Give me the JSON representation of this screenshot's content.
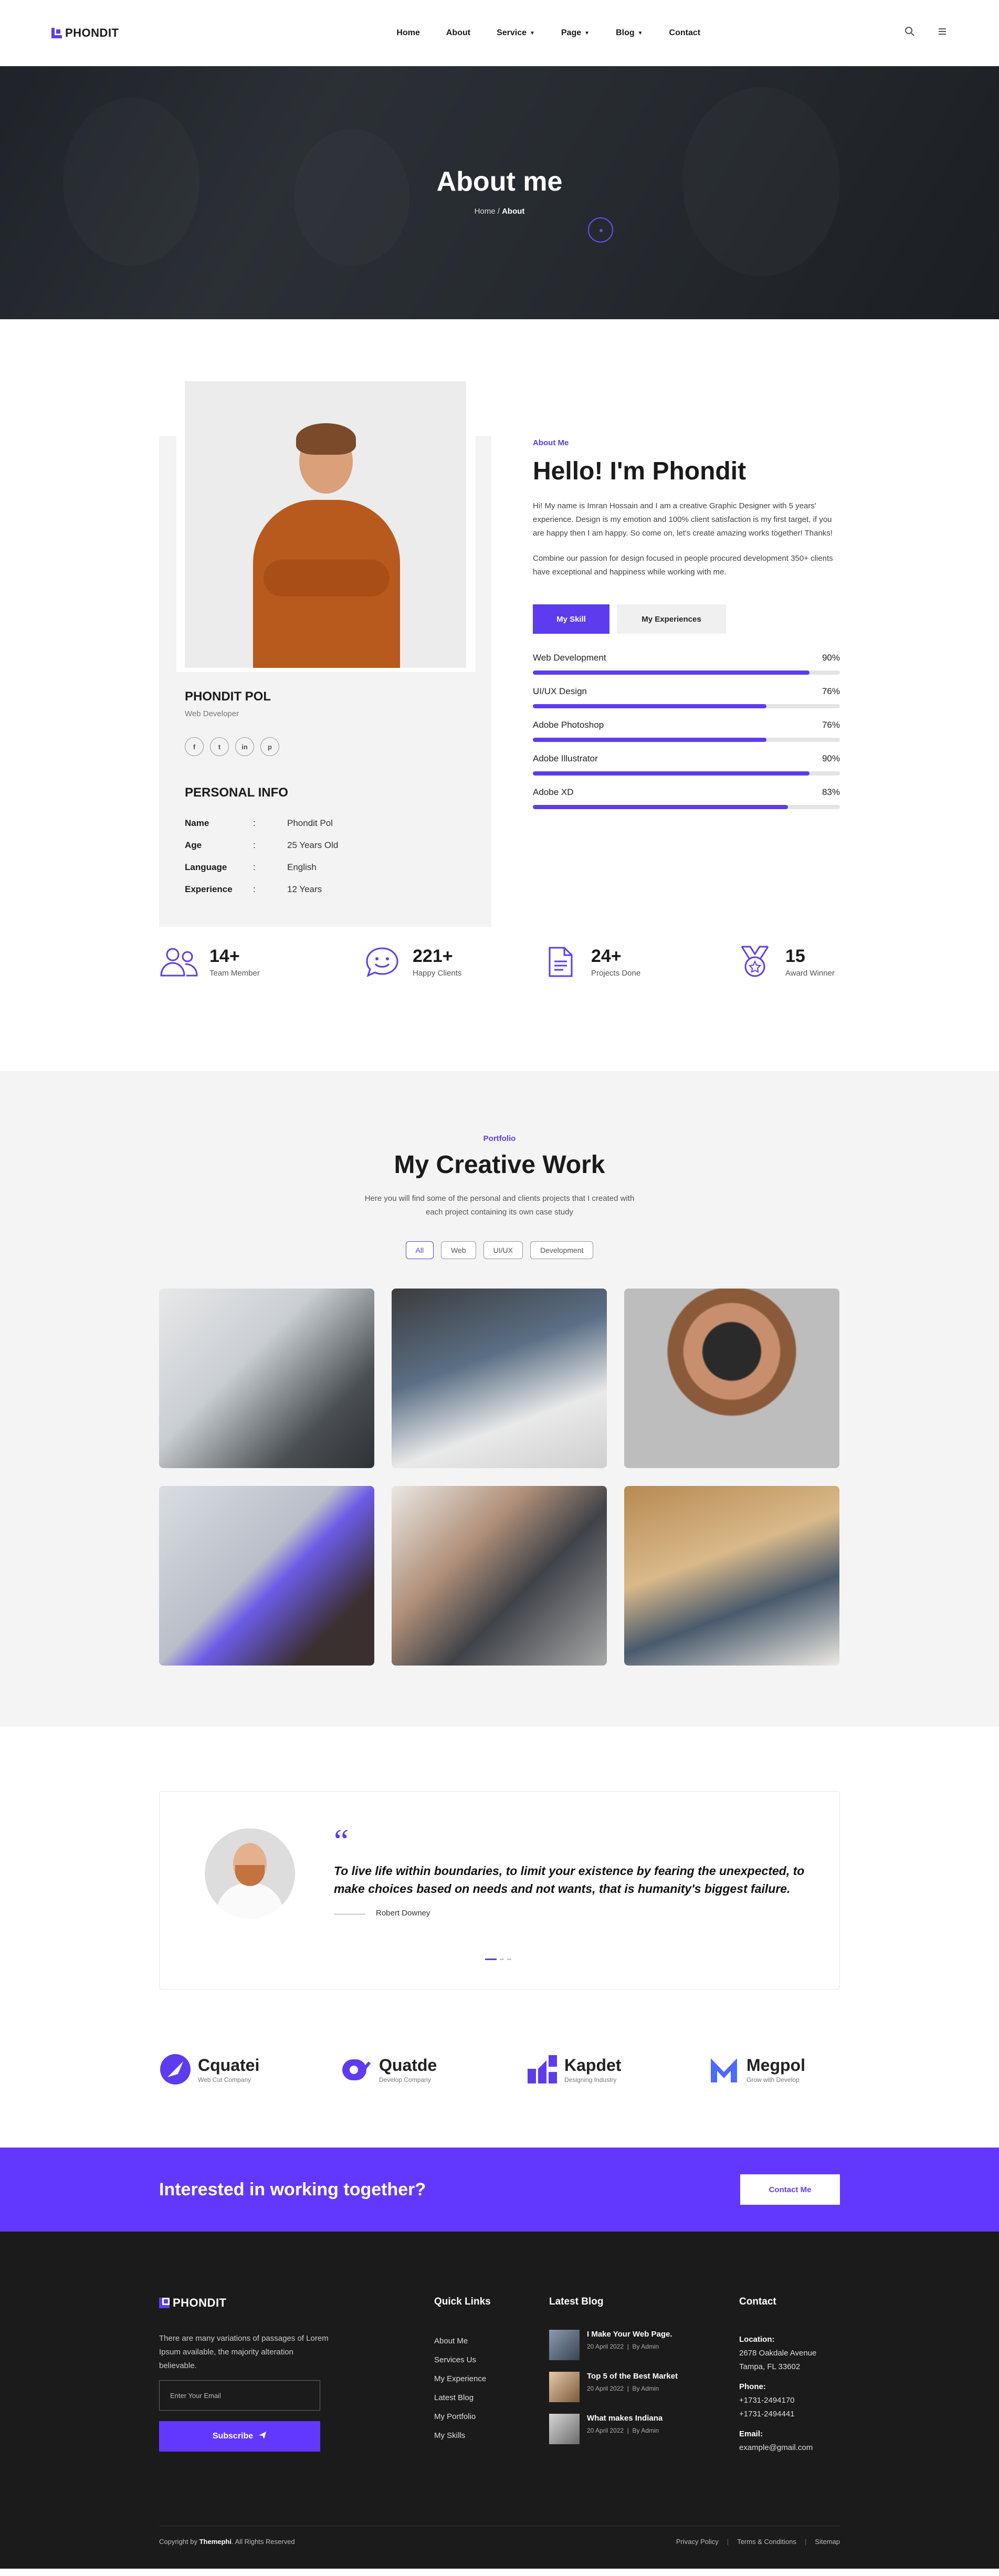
{
  "header": {
    "logo": "PHONDIT",
    "nav": [
      {
        "label": "Home",
        "dropdown": false
      },
      {
        "label": "About",
        "dropdown": false
      },
      {
        "label": "Service",
        "dropdown": true
      },
      {
        "label": "Page",
        "dropdown": true
      },
      {
        "label": "Blog",
        "dropdown": true
      },
      {
        "label": "Contact",
        "dropdown": false
      }
    ]
  },
  "hero": {
    "title": "About me",
    "breadcrumb_home": "Home",
    "breadcrumb_sep": "/",
    "breadcrumb_current": "About"
  },
  "profile": {
    "name": "PHONDIT POL",
    "role": "Web Developer",
    "socials": [
      "f",
      "t",
      "in",
      "p"
    ],
    "info_title": "PERSONAL INFO",
    "info": [
      {
        "key": "Name",
        "sep": ":",
        "value": "Phondit Pol"
      },
      {
        "key": "Age",
        "sep": ":",
        "value": "25 Years Old"
      },
      {
        "key": "Language",
        "sep": ":",
        "value": "English"
      },
      {
        "key": "Experience",
        "sep": ":",
        "value": "12 Years"
      }
    ]
  },
  "about": {
    "eyebrow": "About Me",
    "title": "Hello! I'm Phondit",
    "para1": "Hi! My name is Imran Hossain and I am a creative Graphic Designer with 5 years' experience. Design is my emotion and 100% client satisfaction is my first target, if you are happy then I am happy. So come on, let's create amazing works together! Thanks!",
    "para2": "Combine our passion for design focused in people procured development 350+ clients have exceptional and happiness while working with me.",
    "tab_skill": "My Skill",
    "tab_exp": "My Experiences",
    "skills": [
      {
        "name": "Web Development",
        "percent_label": "90%",
        "value": 0.9
      },
      {
        "name": "UI/UX Design",
        "percent_label": "76%",
        "value": 0.76
      },
      {
        "name": "Adobe Photoshop",
        "percent_label": "76%",
        "value": 0.76
      },
      {
        "name": "Adobe Illustrator",
        "percent_label": "90%",
        "value": 0.9
      },
      {
        "name": "Adobe XD",
        "percent_label": "83%",
        "value": 0.83
      }
    ]
  },
  "counters": [
    {
      "number": "14+",
      "label": "Team Member",
      "icon": "users-icon"
    },
    {
      "number": "221+",
      "label": "Happy Clients",
      "icon": "smile-chat-icon"
    },
    {
      "number": "24+",
      "label": "Projects Done",
      "icon": "document-icon"
    },
    {
      "number": "15",
      "label": "Award Winner",
      "icon": "medal-icon"
    }
  ],
  "portfolio": {
    "eyebrow": "Portfolio",
    "title": "My Creative Work",
    "desc": "Here you will find some of the personal and clients projects that I created with each project containing its own case study",
    "filters": [
      "All",
      "Web",
      "UI/UX",
      "Development"
    ]
  },
  "testimonial": {
    "quote": "To live life within boundaries, to limit your existence by fearing the unexpected, to make choices based on needs and not wants, that is humanity's biggest failure.",
    "author": "Robert Downey"
  },
  "brands": [
    {
      "name": "Cquatei",
      "sub": "Web Cut Company"
    },
    {
      "name": "Quatde",
      "sub": "Develop Company"
    },
    {
      "name": "Kapdet",
      "sub": "Designing Industry"
    },
    {
      "name": "Megpol",
      "sub": "Grow with Develop"
    }
  ],
  "cta": {
    "title": "Interested in working together?",
    "button": "Contact Me"
  },
  "footer": {
    "logo": "PHONDIT",
    "desc": "There are many variations of passages of Lorem Ipsum available, the majority alteration believable.",
    "email_placeholder": "Enter Your Email",
    "subscribe": "Subscribe",
    "quick_title": "Quick Links",
    "quick_links": [
      "About Me",
      "Services Us",
      "My Experience",
      "Latest Blog",
      "My Portfolio",
      "My Skills"
    ],
    "blog_title": "Latest Blog",
    "posts": [
      {
        "title": "I Make Your Web Page.",
        "date": "20 April 2022",
        "by": "By Admin"
      },
      {
        "title": "Top 5 of the Best Market",
        "date": "20 April 2022",
        "by": "By Admin"
      },
      {
        "title": "What makes Indiana",
        "date": "20 April 2022",
        "by": "By Admin"
      }
    ],
    "contact_title": "Contact",
    "location_label": "Location:",
    "location_1": "2678 Oakdale Avenue",
    "location_2": "Tampa, FL 33602",
    "phone_label": "Phone:",
    "phone_1": "+1731-2494170",
    "phone_2": "+1731-2494441",
    "email_label": "Email:",
    "email": "example@gmail.com",
    "copyright_pre": "Copyright by ",
    "copyright_brand": "Themephi",
    "copyright_post": ". All Rights Reserved",
    "bottom_links": [
      "Privacy Policy",
      "Terms & Conditions",
      "Sitemap"
    ]
  },
  "colors": {
    "accent": "#5e3bee",
    "cta": "#6238ff",
    "footer_bg": "#1b1b1b"
  }
}
